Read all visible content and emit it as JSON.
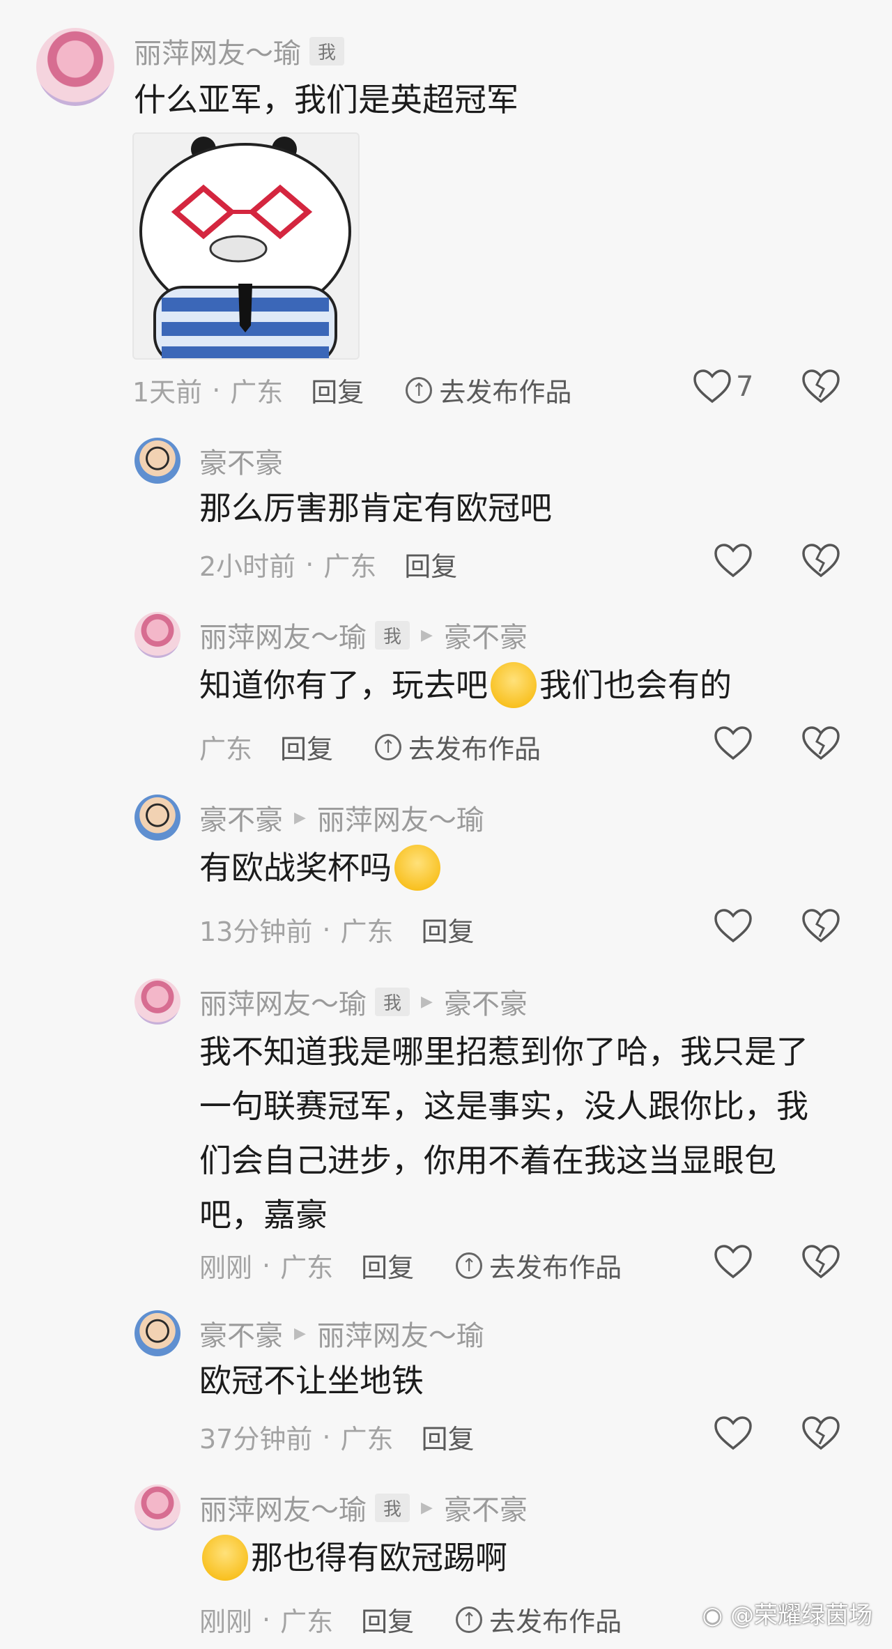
{
  "comments": [
    {
      "nick": "丽萍网友～瑜",
      "badge": "我",
      "text": "什么亚军，我们是英超冠军",
      "time": "1天前",
      "location": "广东",
      "reply_label": "回复",
      "post_label": "去发布作品",
      "likes": "7"
    },
    {
      "nick": "豪不豪",
      "text": "那么厉害那肯定有欧冠吧",
      "time": "2小时前",
      "location": "广东",
      "reply_label": "回复"
    },
    {
      "nick": "丽萍网友～瑜",
      "badge": "我",
      "reply_to": "豪不豪",
      "text_a": "知道你有了，玩去吧",
      "text_b": "我们也会有的",
      "location": "广东",
      "reply_label": "回复",
      "post_label": "去发布作品"
    },
    {
      "nick": "豪不豪",
      "reply_to": "丽萍网友～瑜",
      "text": "有欧战奖杯吗",
      "time": "13分钟前",
      "location": "广东",
      "reply_label": "回复"
    },
    {
      "nick": "丽萍网友～瑜",
      "badge": "我",
      "reply_to": "豪不豪",
      "text_lines": [
        "我不知道我是哪里招惹到你了哈，我只是了",
        "一句联赛冠军，这是事实，没人跟你比，我",
        "们会自己进步，你用不着在我这当显眼包",
        "吧，嘉豪"
      ],
      "time": "刚刚",
      "location": "广东",
      "reply_label": "回复",
      "post_label": "去发布作品"
    },
    {
      "nick": "豪不豪",
      "reply_to": "丽萍网友～瑜",
      "text": "欧冠不让坐地铁",
      "time": "37分钟前",
      "location": "广东",
      "reply_label": "回复"
    },
    {
      "nick": "丽萍网友～瑜",
      "badge": "我",
      "reply_to": "豪不豪",
      "text": "那也得有欧冠踢啊",
      "time": "刚刚",
      "location": "广东",
      "reply_label": "回复",
      "post_label": "去发布作品"
    }
  ],
  "meta_separator": "·",
  "watermark": "@荣耀绿茵场",
  "icons": [
    "heart-icon",
    "dislike-heart-icon",
    "upload-arrow-icon",
    "weibo-icon"
  ]
}
